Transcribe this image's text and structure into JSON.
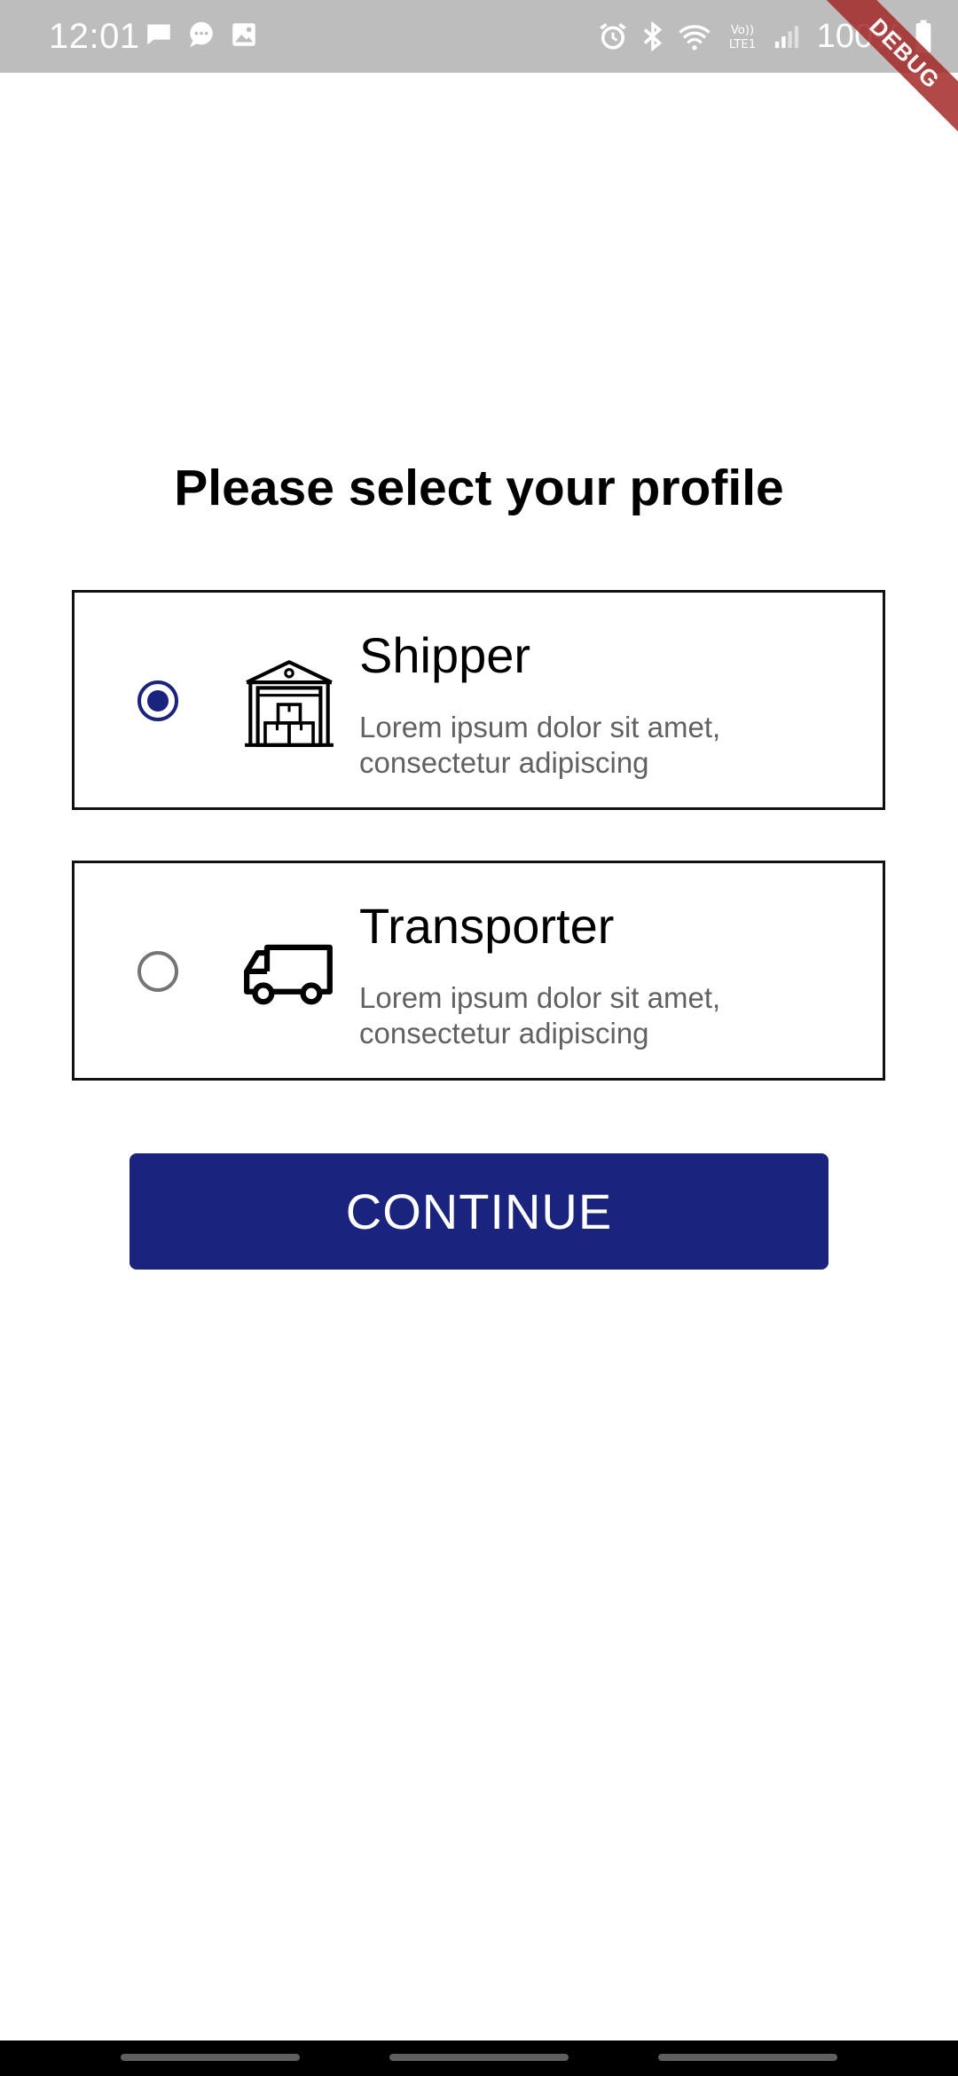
{
  "status_bar": {
    "time": "12:01",
    "battery_percent": "100%",
    "left_icons": [
      "message-icon",
      "chat-bubble-icon",
      "image-icon"
    ],
    "right_icons": [
      "alarm-icon",
      "bluetooth-icon",
      "wifi-icon",
      "volte-lte-icon",
      "signal-icon",
      "battery-icon"
    ]
  },
  "debug_banner": {
    "label": "DEBUG"
  },
  "page": {
    "title": "Please select your profile"
  },
  "options": [
    {
      "title": "Shipper",
      "description": "Lorem ipsum dolor sit amet, consectetur adipiscing",
      "icon": "warehouse-icon",
      "selected": true
    },
    {
      "title": "Transporter",
      "description": "Lorem ipsum dolor sit amet, consectetur adipiscing",
      "icon": "truck-icon",
      "selected": false
    }
  ],
  "continue_button": {
    "label": "CONTINUE"
  },
  "colors": {
    "primary": "#1a237e",
    "status_bar": "#bdbdbd",
    "card_border": "#111111",
    "secondary_text": "#616161"
  }
}
